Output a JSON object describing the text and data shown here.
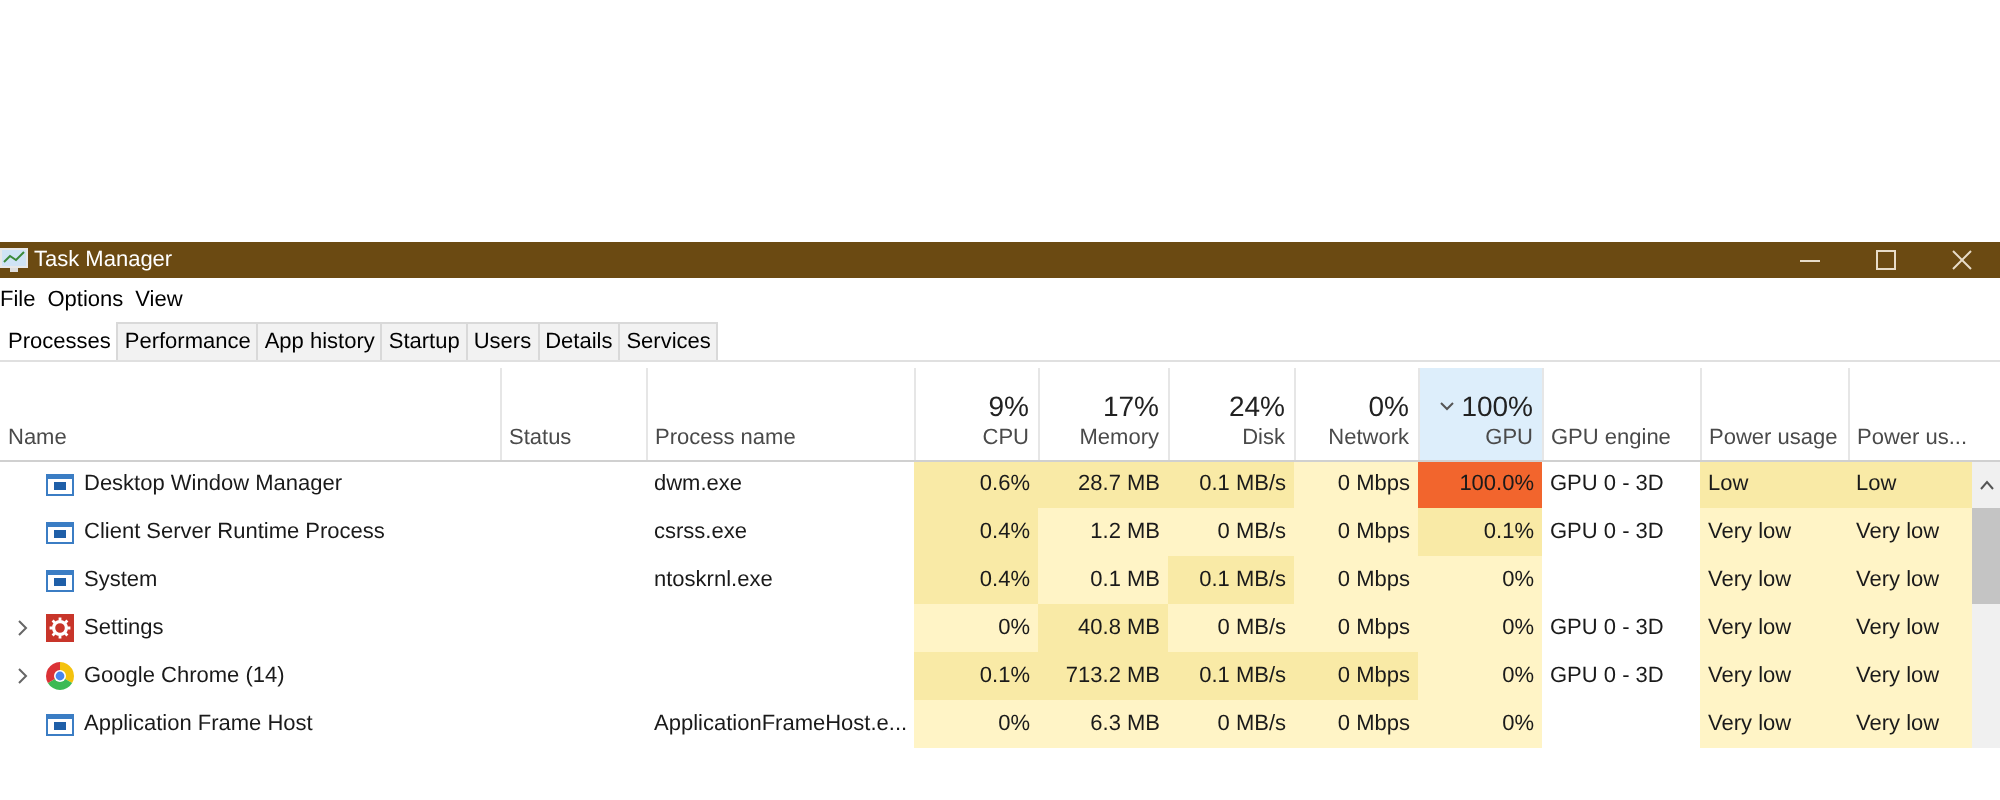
{
  "window": {
    "title": "Task Manager"
  },
  "menu": [
    "File",
    "Options",
    "View"
  ],
  "tabs": [
    {
      "label": "Processes",
      "selected": true
    },
    {
      "label": "Performance",
      "selected": false
    },
    {
      "label": "App history",
      "selected": false
    },
    {
      "label": "Startup",
      "selected": false
    },
    {
      "label": "Users",
      "selected": false
    },
    {
      "label": "Details",
      "selected": false
    },
    {
      "label": "Services",
      "selected": false
    }
  ],
  "columns": [
    {
      "label": "Name",
      "sorted": false
    },
    {
      "label": "Status",
      "sorted": false
    },
    {
      "label": "Process name",
      "sorted": false
    },
    {
      "label": "CPU",
      "usage": "9%",
      "sorted": false
    },
    {
      "label": "Memory",
      "usage": "17%",
      "sorted": false
    },
    {
      "label": "Disk",
      "usage": "24%",
      "sorted": false
    },
    {
      "label": "Network",
      "usage": "0%",
      "sorted": false
    },
    {
      "label": "GPU",
      "usage": "100%",
      "sorted": true
    },
    {
      "label": "GPU engine",
      "sorted": false
    },
    {
      "label": "Power usage",
      "sorted": false
    },
    {
      "label": "Power us...",
      "sorted": false
    }
  ],
  "rows": [
    {
      "name": "Desktop Window Manager",
      "kind": "window",
      "expandable": false,
      "cells": [
        null,
        {
          "text": "dwm.exe"
        },
        {
          "text": "0.6%",
          "color": "#f9eaa6"
        },
        {
          "text": "28.7 MB",
          "color": "#f9eaa6"
        },
        {
          "text": "0.1 MB/s",
          "color": "#f9eaa6"
        },
        {
          "text": "0 Mbps",
          "color": "#fff4c6"
        },
        {
          "text": "100.0%",
          "color": "#f2652d"
        },
        {
          "text": "GPU 0 - 3D"
        },
        {
          "text": "Low",
          "color": "#f9eaa6"
        },
        {
          "text": "Low",
          "color": "#f9eaa6"
        }
      ]
    },
    {
      "name": "Client Server Runtime Process",
      "kind": "window",
      "expandable": false,
      "cells": [
        null,
        {
          "text": "csrss.exe"
        },
        {
          "text": "0.4%",
          "color": "#f9eaa6"
        },
        {
          "text": "1.2 MB",
          "color": "#fff4c6"
        },
        {
          "text": "0 MB/s",
          "color": "#fff4c6"
        },
        {
          "text": "0 Mbps",
          "color": "#fff4c6"
        },
        {
          "text": "0.1%",
          "color": "#f9eaa6"
        },
        {
          "text": "GPU 0 - 3D"
        },
        {
          "text": "Very low",
          "color": "#fff4c6"
        },
        {
          "text": "Very low",
          "color": "#fff4c6"
        }
      ]
    },
    {
      "name": "System",
      "kind": "window",
      "expandable": false,
      "cells": [
        null,
        {
          "text": "ntoskrnl.exe"
        },
        {
          "text": "0.4%",
          "color": "#f9eaa6"
        },
        {
          "text": "0.1 MB",
          "color": "#fff4c6"
        },
        {
          "text": "0.1 MB/s",
          "color": "#f9eaa6"
        },
        {
          "text": "0 Mbps",
          "color": "#fff4c6"
        },
        {
          "text": "0%",
          "color": "#fff4c6"
        },
        null,
        {
          "text": "Very low",
          "color": "#fff4c6"
        },
        {
          "text": "Very low",
          "color": "#fff4c6"
        }
      ]
    },
    {
      "name": "Settings",
      "kind": "settings",
      "expandable": true,
      "cells": [
        null,
        null,
        {
          "text": "0%",
          "color": "#fff4c6"
        },
        {
          "text": "40.8 MB",
          "color": "#f9eaa6"
        },
        {
          "text": "0 MB/s",
          "color": "#fff4c6"
        },
        {
          "text": "0 Mbps",
          "color": "#fff4c6"
        },
        {
          "text": "0%",
          "color": "#fff4c6"
        },
        {
          "text": "GPU 0 - 3D"
        },
        {
          "text": "Very low",
          "color": "#fff4c6"
        },
        {
          "text": "Very low",
          "color": "#fff4c6"
        }
      ]
    },
    {
      "name": "Google Chrome (14)",
      "kind": "browser",
      "expandable": true,
      "cells": [
        null,
        null,
        {
          "text": "0.1%",
          "color": "#f9eaa6"
        },
        {
          "text": "713.2 MB",
          "color": "#f9eaa6"
        },
        {
          "text": "0.1 MB/s",
          "color": "#f9eaa6"
        },
        {
          "text": "0 Mbps",
          "color": "#f9eaa6"
        },
        {
          "text": "0%",
          "color": "#fff4c6"
        },
        {
          "text": "GPU 0 - 3D"
        },
        {
          "text": "Very low",
          "color": "#fff4c6"
        },
        {
          "text": "Very low",
          "color": "#fff4c6"
        }
      ]
    },
    {
      "name": "Application Frame Host",
      "kind": "window",
      "expandable": false,
      "cells": [
        null,
        {
          "text": "ApplicationFrameHost.e..."
        },
        {
          "text": "0%",
          "color": "#fff4c6"
        },
        {
          "text": "6.3 MB",
          "color": "#fff4c6"
        },
        {
          "text": "0 MB/s",
          "color": "#fff4c6"
        },
        {
          "text": "0 Mbps",
          "color": "#fff4c6"
        },
        {
          "text": "0%",
          "color": "#fff4c6"
        },
        null,
        {
          "text": "Very low",
          "color": "#fff4c6"
        },
        {
          "text": "Very low",
          "color": "#fff4c6"
        }
      ]
    }
  ]
}
